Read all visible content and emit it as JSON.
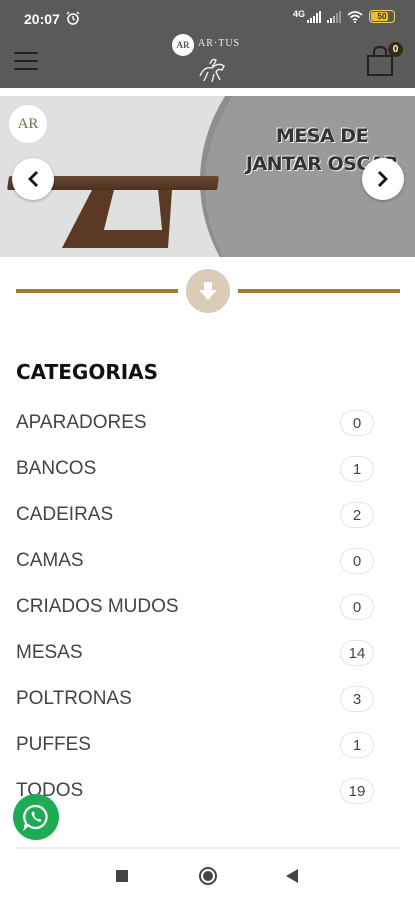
{
  "status_bar": {
    "time": "20:07",
    "network": "4G",
    "battery": "50",
    "icons": [
      "alarm-icon",
      "signal-icon",
      "signal-icon",
      "wifi-icon",
      "battery-icon"
    ]
  },
  "header": {
    "logo_text": "AR·TUS",
    "logo_mark": "AR",
    "cart_count": "0",
    "icons": [
      "hamburger-menu-icon",
      "shopping-bag-icon"
    ]
  },
  "banner": {
    "logo_mark": "AR",
    "title_line1": "MESA DE",
    "title_line2": "JANTAR OSCAR",
    "icons": [
      "chevron-left-icon",
      "chevron-right-icon"
    ]
  },
  "divider": {
    "icon": "arrow-down-icon"
  },
  "categories": {
    "title": "CATEGORIAS",
    "items": [
      {
        "name": "APARADORES",
        "count": "0"
      },
      {
        "name": "BANCOS",
        "count": "1"
      },
      {
        "name": "CADEIRAS",
        "count": "2"
      },
      {
        "name": "CAMAS",
        "count": "0"
      },
      {
        "name": "CRIADOS MUDOS",
        "count": "0"
      },
      {
        "name": "MESAS",
        "count": "14"
      },
      {
        "name": "POLTRONAS",
        "count": "3"
      },
      {
        "name": "PUFFES",
        "count": "1"
      },
      {
        "name": "TODOS",
        "count": "19"
      }
    ]
  },
  "floating": {
    "icon": "whatsapp-icon"
  },
  "system_nav": {
    "icons": [
      "recents-icon",
      "home-icon",
      "back-icon"
    ]
  },
  "colors": {
    "header_bg": "#5a5a5a",
    "accent_gold": "#a97b28",
    "down_button_bg": "#d9cbb5",
    "whatsapp_green": "#1faa54"
  }
}
